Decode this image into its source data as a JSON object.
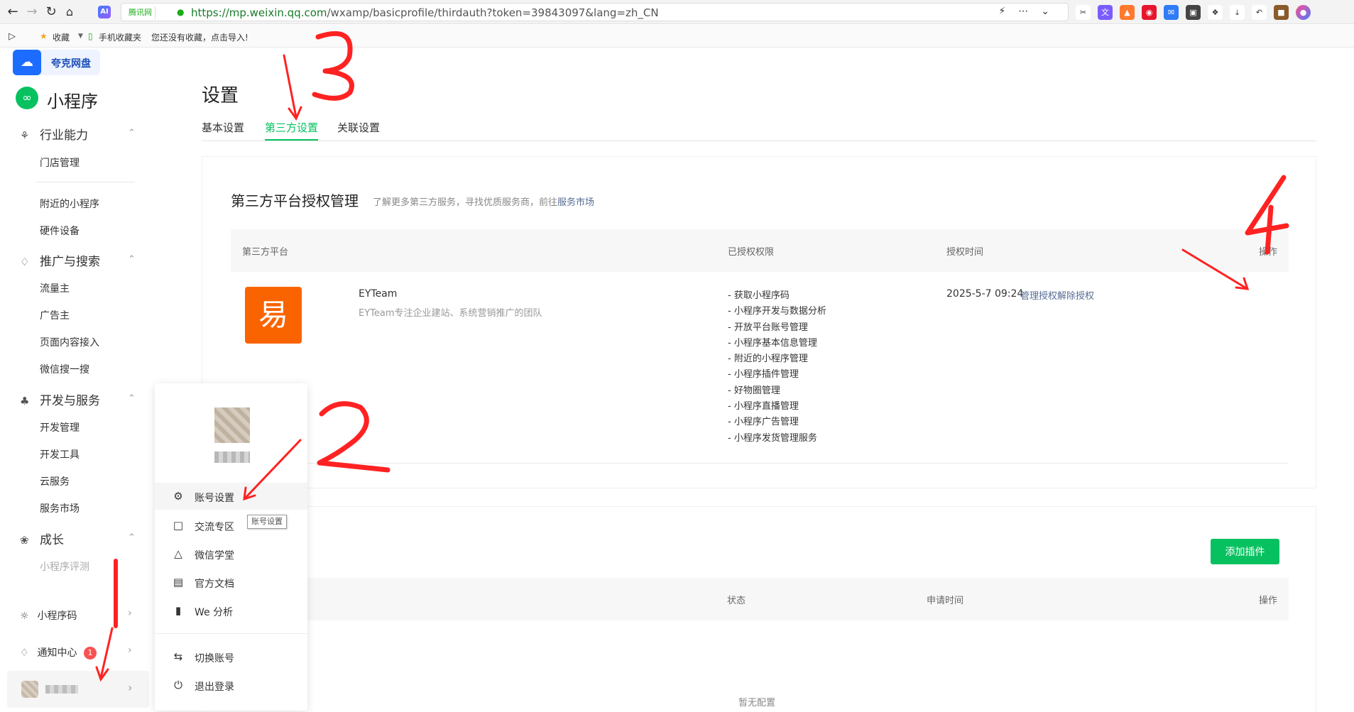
{
  "browser": {
    "site_badge": "腾讯网",
    "url_host": "https://mp.weixin.qq.com",
    "url_path": "/wxamp/basicprofile/thirdauth?token=39843097&lang=zh_CN",
    "ai_label": "AI"
  },
  "bookmarks": {
    "favorites": "收藏",
    "mobile": "手机收藏夹",
    "hint": "您还没有收藏，点击导入!"
  },
  "quark": {
    "label": "夸克网盘"
  },
  "brand": {
    "title": "小程序"
  },
  "sidebar": {
    "group_industry": "行业能力",
    "store": "门店管理",
    "nearby": "附近的小程序",
    "hardware": "硬件设备",
    "group_promo": "推广与搜索",
    "traffic": "流量主",
    "advertiser": "广告主",
    "page_content": "页面内容接入",
    "wechat_search": "微信搜一搜",
    "group_dev": "开发与服务",
    "dev_manage": "开发管理",
    "dev_tools": "开发工具",
    "cloud": "云服务",
    "service_market": "服务市场",
    "group_growth": "成长",
    "evaluation": "小程序评测",
    "qrcode": "小程序码",
    "notice": "通知中心",
    "notice_count": "1"
  },
  "page": {
    "title": "设置",
    "tabs": [
      "基本设置",
      "第三方设置",
      "关联设置"
    ]
  },
  "third_party": {
    "title": "第三方平台授权管理",
    "desc": "了解更多第三方服务，寻找优质服务商，前往",
    "desc_link": "服务市场",
    "columns": [
      "第三方平台",
      "已授权权限",
      "授权时间",
      "操作"
    ],
    "row": {
      "logo_char": "易",
      "name": "EYTeam",
      "desc": "EYTeam专注企业建站、系统营销推广的团队",
      "permissions": [
        "- 获取小程序码",
        "- 小程序开发与数据分析",
        "- 开放平台账号管理",
        "- 小程序基本信息管理",
        "- 附近的小程序管理",
        "- 小程序插件管理",
        "- 好物圈管理",
        "- 小程序直播管理",
        "- 小程序广告管理",
        "- 小程序发货管理服务"
      ],
      "time": "2025-5-7 09:24",
      "manage": "管理授权",
      "revoke": "解除授权"
    }
  },
  "plugin": {
    "add_button": "添加插件",
    "columns": [
      "状态",
      "申请时间",
      "操作"
    ],
    "empty": "暂无配置"
  },
  "popover": {
    "items": [
      "账号设置",
      "交流专区",
      "微信学堂",
      "官方文档",
      "We 分析",
      "切换账号",
      "退出登录"
    ],
    "tooltip": "账号设置"
  },
  "annotations": [
    "3",
    "4",
    "2"
  ]
}
